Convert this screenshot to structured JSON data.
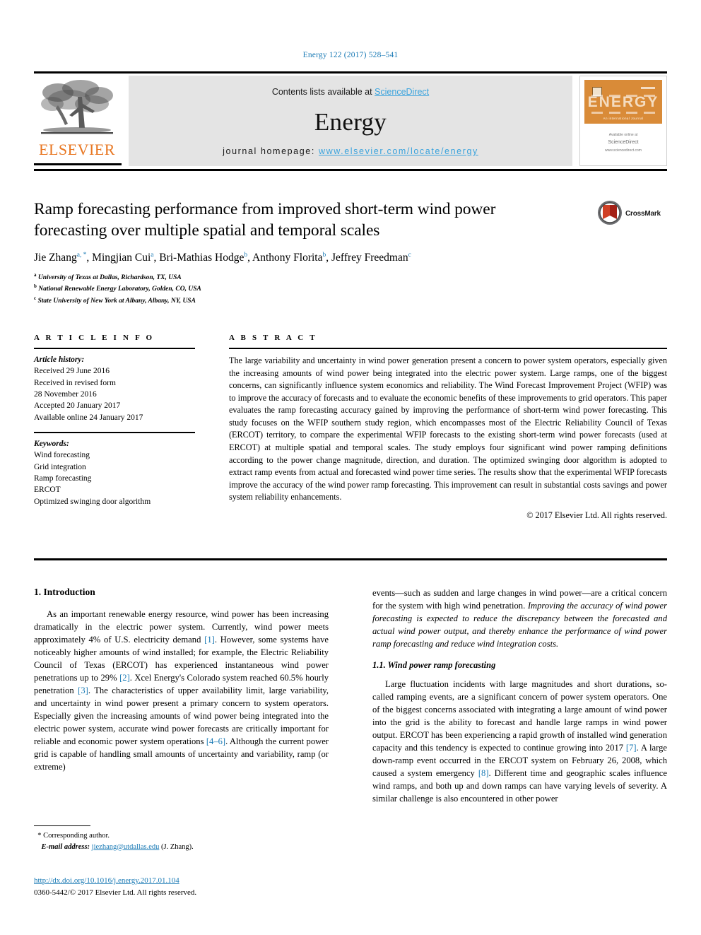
{
  "running_head": "Energy 122 (2017) 528–541",
  "masthead": {
    "contents_prefix": "Contents lists available at ",
    "contents_link": "ScienceDirect",
    "journal_title": "Energy",
    "homepage_prefix": "journal homepage: ",
    "homepage_url": "www.elsevier.com/locate/energy",
    "publisher_wordmark": "ELSEVIER",
    "cover": {
      "wordmark": "ENERGY",
      "tagline": "An international Journal",
      "footer_line1": "Available online at",
      "footer_line2": "ScienceDirect",
      "footer_line3": "www.sciencedirect.com"
    }
  },
  "article": {
    "title": "Ramp forecasting performance from improved short-term wind power forecasting over multiple spatial and temporal scales",
    "authors": [
      {
        "name": "Jie Zhang",
        "marks": "a, *"
      },
      {
        "name": "Mingjian Cui",
        "marks": "a"
      },
      {
        "name": "Bri-Mathias Hodge",
        "marks": "b"
      },
      {
        "name": "Anthony Florita",
        "marks": "b"
      },
      {
        "name": "Jeffrey Freedman",
        "marks": "c"
      }
    ],
    "affiliations": [
      {
        "mark": "a",
        "text": "University of Texas at Dallas, Richardson, TX, USA"
      },
      {
        "mark": "b",
        "text": "National Renewable Energy Laboratory, Golden, CO, USA"
      },
      {
        "mark": "c",
        "text": "State University of New York at Albany, Albany, NY, USA"
      }
    ],
    "crossmark_label": "CrossMark"
  },
  "article_info": {
    "heading": "A R T I C L E   I N F O",
    "history_label": "Article history:",
    "history": [
      "Received 29 June 2016",
      "Received in revised form",
      "28 November 2016",
      "Accepted 20 January 2017",
      "Available online 24 January 2017"
    ],
    "keywords_label": "Keywords:",
    "keywords": [
      "Wind forecasting",
      "Grid integration",
      "Ramp forecasting",
      "ERCOT",
      "Optimized swinging door algorithm"
    ]
  },
  "abstract": {
    "heading": "A B S T R A C T",
    "text": "The large variability and uncertainty in wind power generation present a concern to power system operators, especially given the increasing amounts of wind power being integrated into the electric power system. Large ramps, one of the biggest concerns, can significantly influence system economics and reliability. The Wind Forecast Improvement Project (WFIP) was to improve the accuracy of forecasts and to evaluate the economic benefits of these improvements to grid operators. This paper evaluates the ramp forecasting accuracy gained by improving the performance of short-term wind power forecasting. This study focuses on the WFIP southern study region, which encompasses most of the Electric Reliability Council of Texas (ERCOT) territory, to compare the experimental WFIP forecasts to the existing short-term wind power forecasts (used at ERCOT) at multiple spatial and temporal scales. The study employs four significant wind power ramping definitions according to the power change magnitude, direction, and duration. The optimized swinging door algorithm is adopted to extract ramp events from actual and forecasted wind power time series. The results show that the experimental WFIP forecasts improve the accuracy of the wind power ramp forecasting. This improvement can result in substantial costs savings and power system reliability enhancements.",
    "copyright": "© 2017 Elsevier Ltd. All rights reserved."
  },
  "body": {
    "section1_heading": "1.  Introduction",
    "left_para1_a": "As an important renewable energy resource, wind power has been increasing dramatically in the electric power system. Currently, wind power meets approximately 4% of U.S. electricity demand ",
    "left_ref1": "[1]",
    "left_para1_b": ". However, some systems have noticeably higher amounts of wind installed; for example, the Electric Reliability Council of Texas (ERCOT) has experienced instantaneous wind power penetrations up to 29% ",
    "left_ref2": "[2]",
    "left_para1_c": ". Xcel Energy's Colorado system reached 60.5% hourly penetration ",
    "left_ref3": "[3]",
    "left_para1_d": ". The characteristics of upper availability limit, large variability, and uncertainty in wind power present a primary concern to system operators. Especially given the increasing amounts of wind power being integrated into the electric power system, accurate wind power forecasts are critically important for reliable and economic power system operations ",
    "left_ref4": "[4–6]",
    "left_para1_e": ". Although the current power grid is capable of handling small amounts of uncertainty and variability, ramp (or extreme)",
    "right_para_cont_a": "events—such as sudden and large changes in wind power—are a critical concern for the system with high wind penetration. ",
    "right_para_cont_italic": "Improving the accuracy of wind power forecasting is expected to reduce the discrepancy between the forecasted and actual wind power output, and thereby enhance the performance of wind power ramp forecasting and reduce wind integration costs.",
    "section11_heading": "1.1.  Wind power ramp forecasting",
    "right_para2_a": "Large fluctuation incidents with large magnitudes and short durations, so-called ramping events, are a significant concern of power system operators. One of the biggest concerns associated with integrating a large amount of wind power into the grid is the ability to forecast and handle large ramps in wind power output. ERCOT has been experiencing a rapid growth of installed wind generation capacity and this tendency is expected to continue growing into 2017 ",
    "right_ref7": "[7]",
    "right_para2_b": ". A large down-ramp event occurred in the ERCOT system on February 26, 2008, which caused a system emergency ",
    "right_ref8": "[8]",
    "right_para2_c": ". Different time and geographic scales influence wind ramps, and both up and down ramps can have varying levels of severity. A similar challenge is also encountered in other power"
  },
  "footer": {
    "corresponding_marker": "*",
    "corresponding_text": "Corresponding author.",
    "email_label": "E-mail address:",
    "email": "jiezhang@utdallas.edu",
    "email_suffix": "(J. Zhang).",
    "doi": "http://dx.doi.org/10.1016/j.energy.2017.01.104",
    "issn_line": "0360-5442/© 2017 Elsevier Ltd. All rights reserved."
  },
  "colors": {
    "link": "#1a7ab5",
    "sciencedirect": "#3aa3dd",
    "elsevier_orange": "#e87722",
    "panel_gray": "#e4e4e4"
  }
}
